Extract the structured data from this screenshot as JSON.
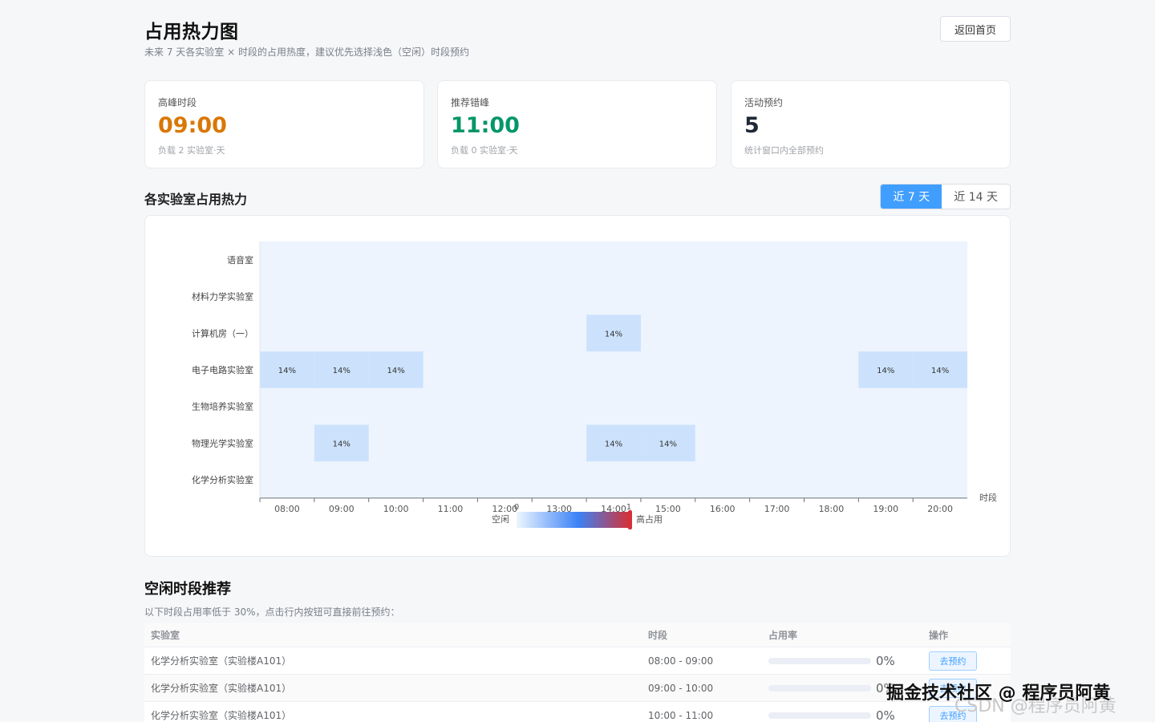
{
  "header": {
    "title": "占用热力图",
    "subtitle": "未来 7 天各实验室 × 时段的占用热度，建议优先选择浅色（空闲）时段预约",
    "home_button": "返回首页"
  },
  "cards": [
    {
      "label": "高峰时段",
      "value": "09:00",
      "note": "负载 2 实验室·天",
      "color": "#d97706"
    },
    {
      "label": "推荐错峰",
      "value": "11:00",
      "note": "负载 0 实验室·天",
      "color": "#059669"
    },
    {
      "label": "活动预约",
      "value": "5",
      "note": "统计窗口内全部预约",
      "color": "#1f2937"
    }
  ],
  "heatmap_section": {
    "title": "各实验室占用热力",
    "range_options": [
      "近 7 天",
      "近 14 天"
    ],
    "active_range": "近 7 天"
  },
  "chart_data": {
    "type": "heatmap",
    "x_axis_name": "时段",
    "x": [
      "08:00",
      "09:00",
      "10:00",
      "11:00",
      "12:00",
      "13:00",
      "14:00",
      "15:00",
      "16:00",
      "17:00",
      "18:00",
      "19:00",
      "20:00"
    ],
    "y": [
      "语音室",
      "材料力学实验室",
      "计算机房（一）",
      "电子电路实验室",
      "生物培养实验室",
      "物理光学实验室",
      "化学分析实验室"
    ],
    "cells": [
      {
        "lab": "计算机房（一）",
        "time": "14:00",
        "value": 0.14,
        "label": "14%"
      },
      {
        "lab": "电子电路实验室",
        "time": "08:00",
        "value": 0.14,
        "label": "14%"
      },
      {
        "lab": "电子电路实验室",
        "time": "09:00",
        "value": 0.14,
        "label": "14%"
      },
      {
        "lab": "电子电路实验室",
        "time": "10:00",
        "value": 0.14,
        "label": "14%"
      },
      {
        "lab": "电子电路实验室",
        "time": "19:00",
        "value": 0.14,
        "label": "14%"
      },
      {
        "lab": "电子电路实验室",
        "time": "20:00",
        "value": 0.14,
        "label": "14%"
      },
      {
        "lab": "物理光学实验室",
        "time": "09:00",
        "value": 0.14,
        "label": "14%"
      },
      {
        "lab": "物理光学实验室",
        "time": "14:00",
        "value": 0.14,
        "label": "14%"
      },
      {
        "lab": "物理光学实验室",
        "time": "15:00",
        "value": 0.14,
        "label": "14%"
      }
    ],
    "visual_map": {
      "min": 0,
      "max": 1,
      "min_label": "0",
      "max_label": "1",
      "low_text": "空闲",
      "high_text": "高占用"
    },
    "colors": {
      "empty": "#edf4fe",
      "filled": "#cce2fc",
      "low": "#eef6ff",
      "mid": "#3b82f6",
      "high": "#d3323a"
    }
  },
  "recommend": {
    "title": "空闲时段推荐",
    "desc": "以下时段占用率低于 30%，点击行内按钮可直接前往预约：",
    "columns": [
      "实验室",
      "时段",
      "占用率",
      "操作"
    ],
    "rows": [
      {
        "lab": "化学分析实验室（实验楼A101）",
        "slot": "08:00 - 09:00",
        "rate": "0%",
        "rate_value": 0,
        "action": "去预约"
      },
      {
        "lab": "化学分析实验室（实验楼A101）",
        "slot": "09:00 - 10:00",
        "rate": "0%",
        "rate_value": 0,
        "action": "去预约"
      },
      {
        "lab": "化学分析实验室（实验楼A101）",
        "slot": "10:00 - 11:00",
        "rate": "0%",
        "rate_value": 0,
        "action": "去预约"
      }
    ]
  },
  "watermark": {
    "primary": "掘金技术社区 @ 程序员阿黄",
    "secondary": "CSDN @程序员阿黄"
  }
}
